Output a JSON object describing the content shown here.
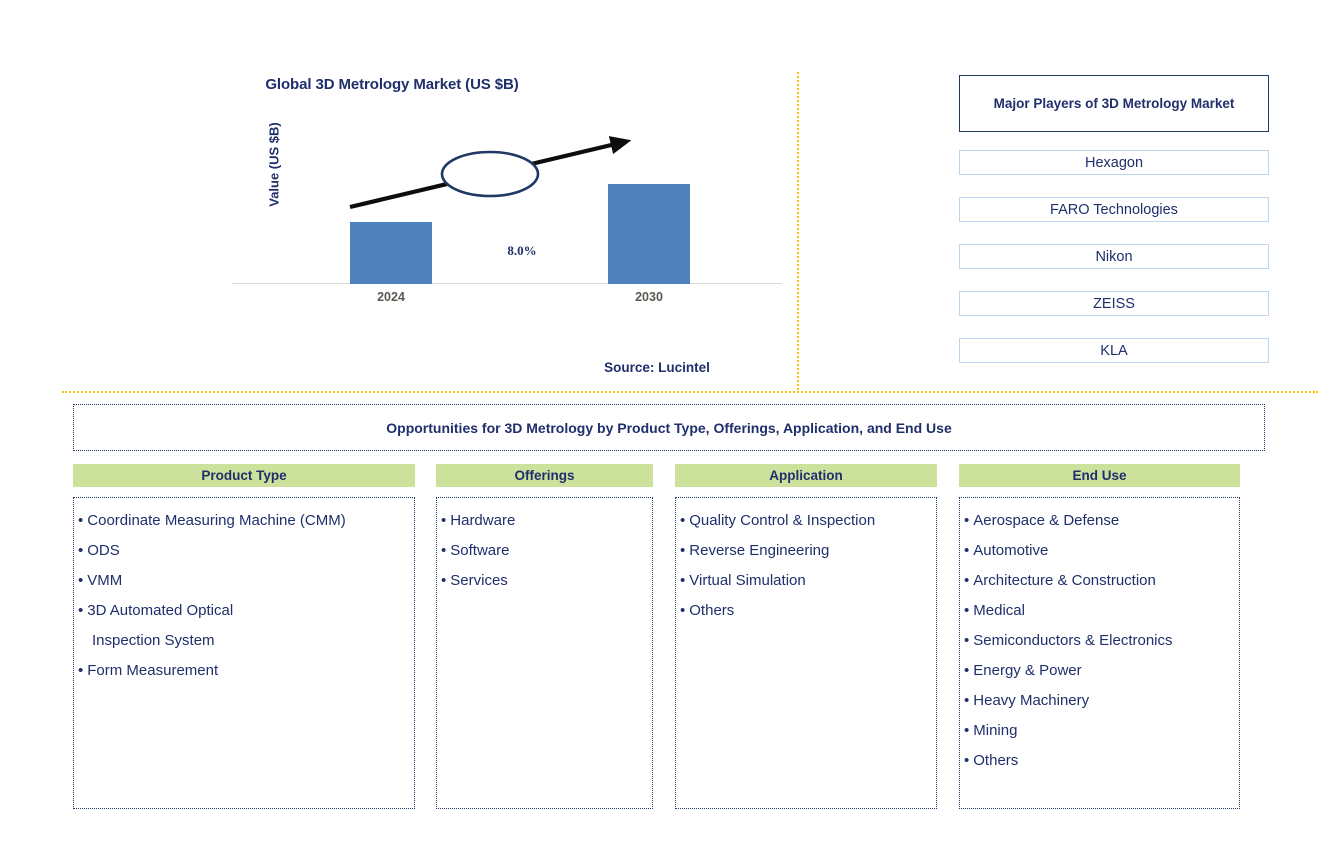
{
  "chart_panel": {
    "title": "Global 3D Metrology Market (US $B)",
    "y_axis_label": "Value (US $B)",
    "cagr_label": "8.0%",
    "source": "Source: Lucintel"
  },
  "chart_data": {
    "type": "bar",
    "title": "Global 3D Metrology Market (US $B)",
    "xlabel": "",
    "ylabel": "Value (US $B)",
    "categories": [
      "2024",
      "2030"
    ],
    "values": [
      6.2,
      10.0
    ],
    "ylim": [
      0,
      12
    ],
    "grid": false,
    "legend_position": "none",
    "bar_color": "#4f81bd",
    "annotations": [
      {
        "text": "8.0%",
        "type": "cagr-callout-ellipse-with-arrow",
        "from_category": "2024",
        "to_category": "2030"
      }
    ],
    "source": "Source: Lucintel"
  },
  "players_panel": {
    "header": "Major Players of 3D Metrology Market",
    "items": [
      "Hexagon",
      "FARO Technologies",
      "Nikon",
      "ZEISS",
      "KLA"
    ]
  },
  "opportunities": {
    "banner": "Opportunities for 3D Metrology by Product Type, Offerings, Application, and End Use",
    "bullet": "•",
    "columns": [
      {
        "header": "Product Type",
        "items": [
          {
            "text": "Coordinate Measuring Machine (CMM)",
            "continuation": false
          },
          {
            "text": "ODS",
            "continuation": false
          },
          {
            "text": "VMM",
            "continuation": false
          },
          {
            "text": "3D Automated Optical",
            "continuation": false
          },
          {
            "text": "Inspection System",
            "continuation": true
          },
          {
            "text": "Form Measurement",
            "continuation": false
          }
        ]
      },
      {
        "header": "Offerings",
        "items": [
          {
            "text": "Hardware",
            "continuation": false
          },
          {
            "text": "Software",
            "continuation": false
          },
          {
            "text": "Services",
            "continuation": false
          }
        ]
      },
      {
        "header": "Application",
        "items": [
          {
            "text": "Quality Control & Inspection",
            "continuation": false
          },
          {
            "text": "Reverse Engineering",
            "continuation": false
          },
          {
            "text": "Virtual Simulation",
            "continuation": false
          },
          {
            "text": "Others",
            "continuation": false
          }
        ]
      },
      {
        "header": "End Use",
        "items": [
          {
            "text": "Aerospace & Defense",
            "continuation": false
          },
          {
            "text": "Automotive",
            "continuation": false
          },
          {
            "text": "Architecture & Construction",
            "continuation": false
          },
          {
            "text": "Medical",
            "continuation": false
          },
          {
            "text": "Semiconductors & Electronics",
            "continuation": false
          },
          {
            "text": "Energy & Power",
            "continuation": false
          },
          {
            "text": "Heavy Machinery",
            "continuation": false
          },
          {
            "text": "Mining",
            "continuation": false
          },
          {
            "text": "Others",
            "continuation": false
          }
        ]
      }
    ]
  },
  "theme": {
    "navy": "#1f2f6b",
    "bar_blue": "#4f81bd",
    "green": "#cce19c",
    "gold_divider": "#ffc000",
    "player_border": "#bcd6ee",
    "tick_gray": "#5a5a52"
  }
}
